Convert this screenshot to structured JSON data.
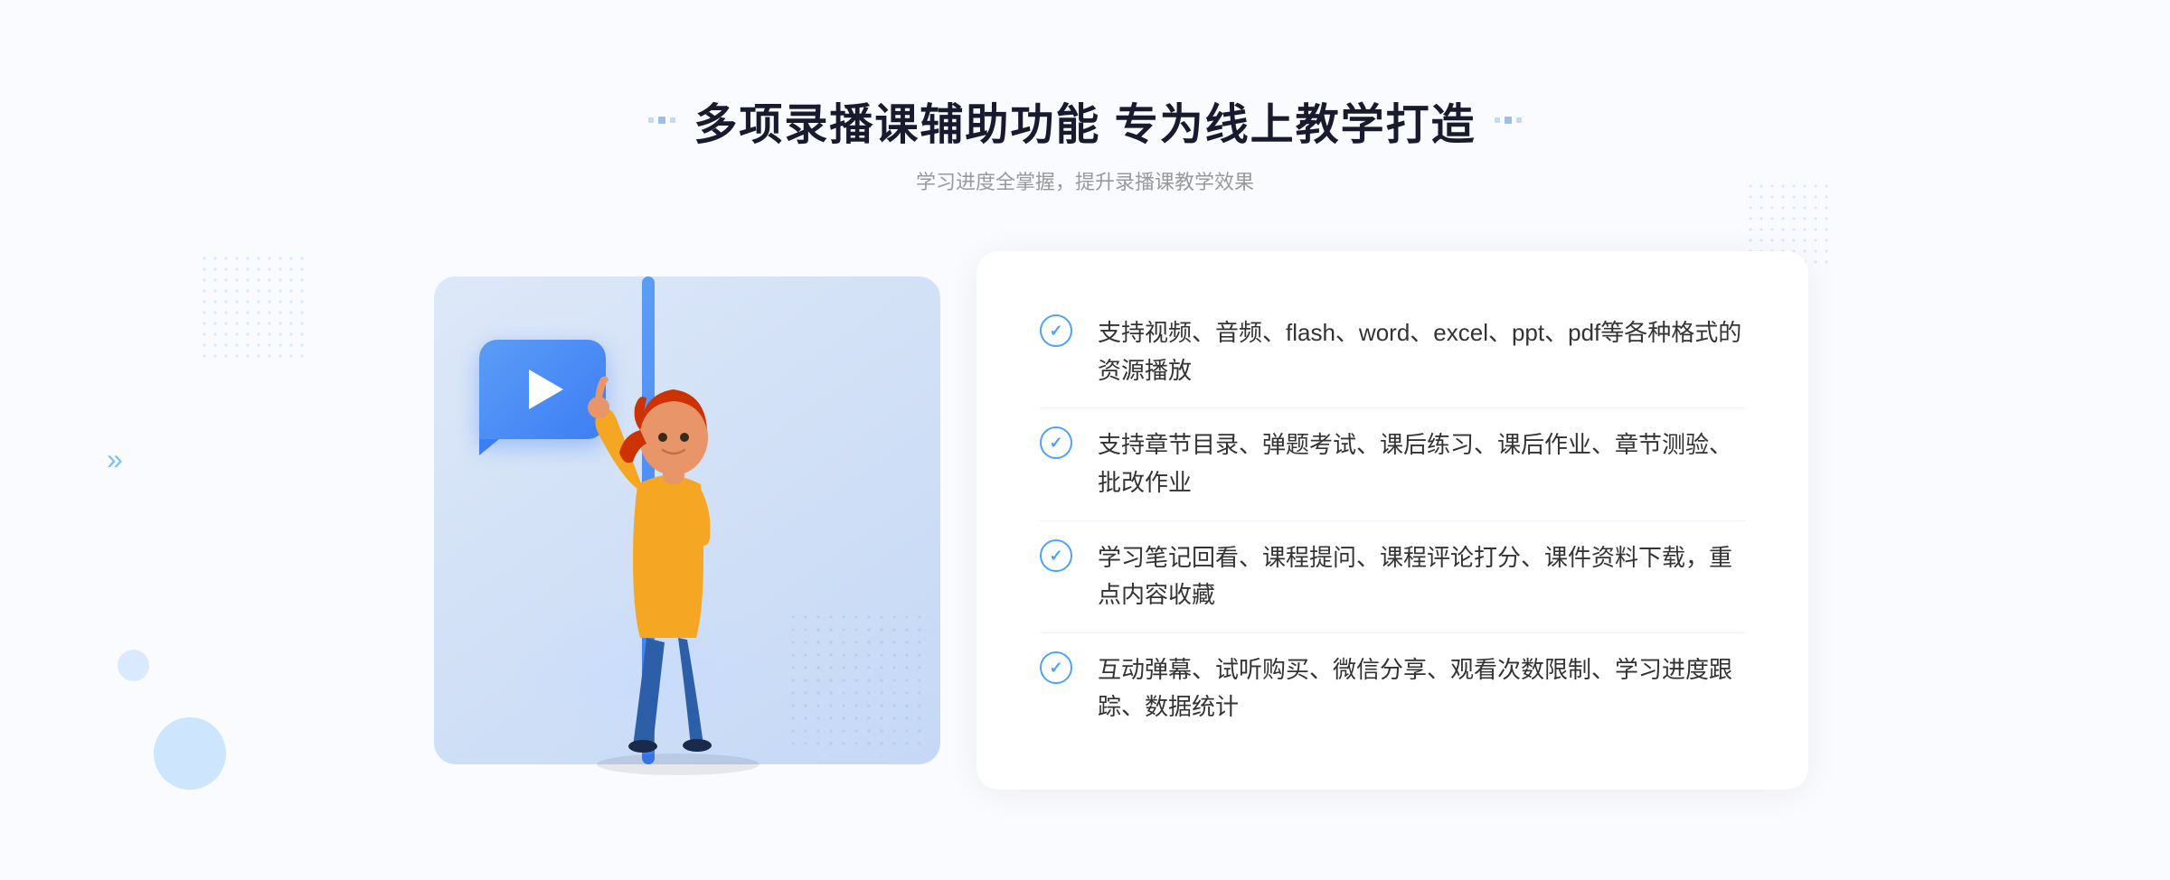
{
  "page": {
    "title": "多项录播课辅助功能 专为线上教学打造",
    "subtitle": "学习进度全掌握，提升录播课教学效果"
  },
  "features": [
    {
      "id": 1,
      "text": "支持视频、音频、flash、word、excel、ppt、pdf等各种格式的资源播放"
    },
    {
      "id": 2,
      "text": "支持章节目录、弹题考试、课后练习、课后作业、章节测验、批改作业"
    },
    {
      "id": 3,
      "text": "学习笔记回看、课程提问、课程评论打分、课件资料下载，重点内容收藏"
    },
    {
      "id": 4,
      "text": "互动弹幕、试听购买、微信分享、观看次数限制、学习进度跟踪、数据统计"
    }
  ],
  "title_dots_label": "title-decoration-dots",
  "arrow_label": "»",
  "check_label": "✓"
}
